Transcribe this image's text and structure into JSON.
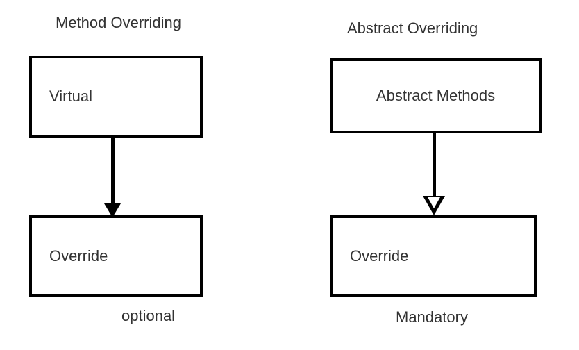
{
  "diagram": {
    "left": {
      "title": "Method Overriding",
      "top_box": "Virtual",
      "bottom_box": "Override",
      "caption": "optional"
    },
    "right": {
      "title": "Abstract Overriding",
      "top_box": "Abstract Methods",
      "bottom_box": "Override",
      "caption": "Mandatory"
    }
  }
}
